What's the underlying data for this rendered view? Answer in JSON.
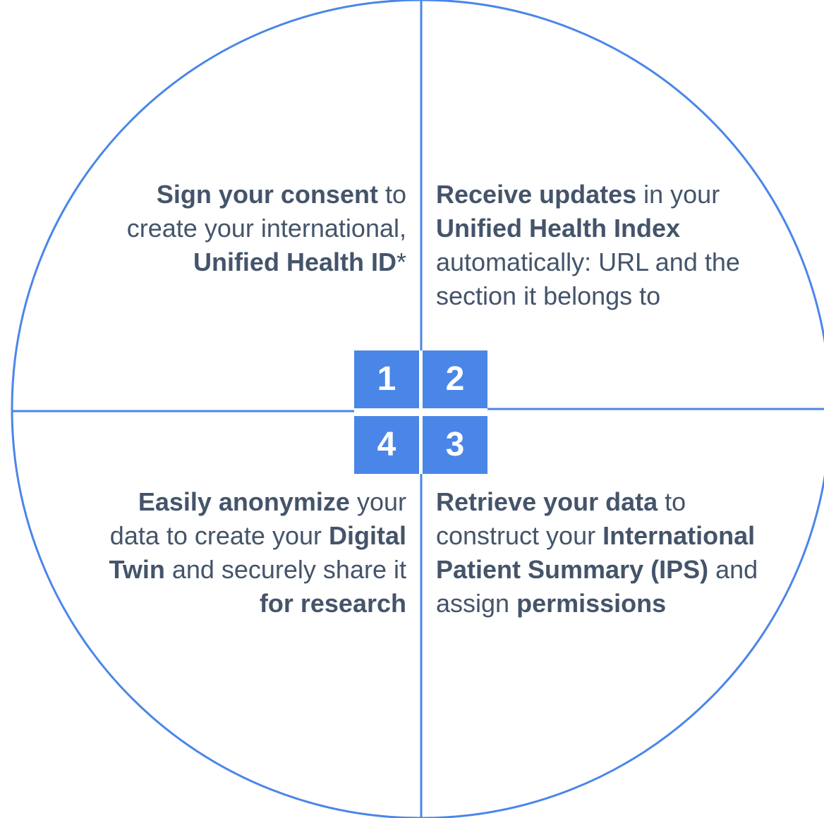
{
  "colors": {
    "accent": "#4a86e8",
    "text": "#44546a",
    "number_text": "#ffffff"
  },
  "numbers": {
    "one": "1",
    "two": "2",
    "three": "3",
    "four": "4"
  },
  "quadrants": {
    "q1": {
      "bold1": "Sign your consent",
      "text1": " to create your international, ",
      "bold2": "Unified Health ID",
      "text2": "*"
    },
    "q2": {
      "bold1": "Receive updates",
      "text1": " in your ",
      "bold2": "Unified Health Index",
      "text2": " automatically: URL and the section it belongs to"
    },
    "q3": {
      "bold1": "Retrieve your data",
      "text1": " to construct your ",
      "bold2": "International Patient Summary (IPS)",
      "text2": " and assign ",
      "bold3": "permissions"
    },
    "q4": {
      "bold1": "Easily anonymize",
      "text1": " your data to create your ",
      "bold2": "Digital Twin",
      "text2": " and securely share it ",
      "bold3": "for research"
    }
  }
}
